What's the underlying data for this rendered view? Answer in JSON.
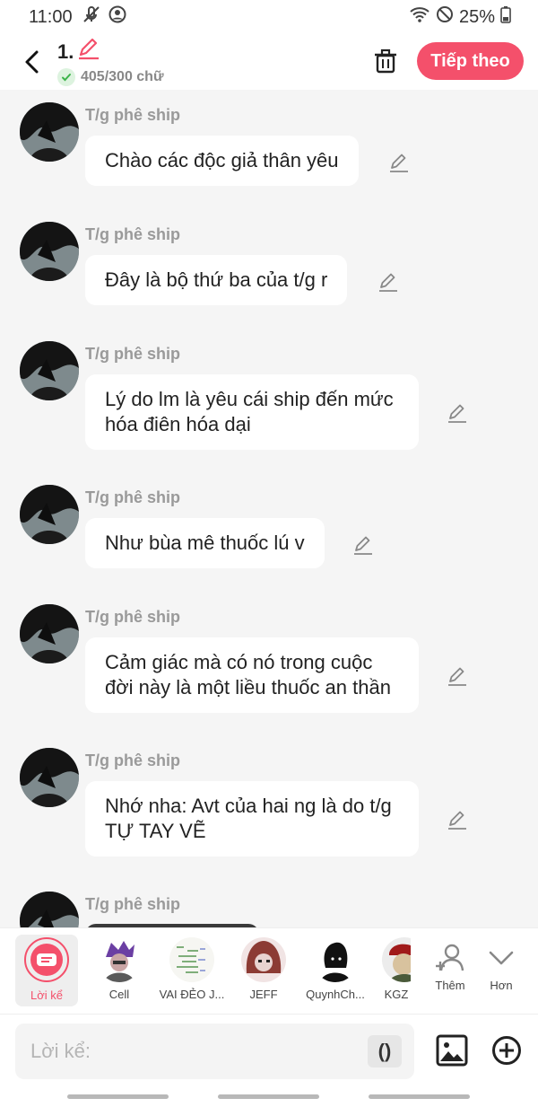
{
  "status_bar": {
    "time": "11:00",
    "battery": "25%"
  },
  "header": {
    "title": "1.",
    "word_count": "405/300 chữ",
    "next_label": "Tiếp theo"
  },
  "messages": [
    {
      "sender": "T/g phê ship",
      "text": "Chào các độc giả thân yêu"
    },
    {
      "sender": "T/g phê ship",
      "text": "Đây là bộ thứ ba của t/g r"
    },
    {
      "sender": "T/g phê ship",
      "text": "Lý do lm là yêu cái ship đến mức hóa điên hóa dại"
    },
    {
      "sender": "T/g phê ship",
      "text": "Như bùa mê thuốc lú v"
    },
    {
      "sender": "T/g phê ship",
      "text": "Cảm giác mà có nó trong cuộc đời này là một liều thuốc an thần"
    },
    {
      "sender": "T/g phê ship",
      "text": "Nhớ nha: Avt của hai ng là do t/g TỰ TAY VẼ"
    },
    {
      "sender": "T/g phê ship",
      "text": ""
    }
  ],
  "characters": {
    "narrator": "Lời kể",
    "list": [
      "Cell",
      "VAI ĐẺO J...",
      "JEFF",
      "QuynhCh...",
      "KGZ"
    ],
    "add_label": "Thêm",
    "more_label": "Hơn"
  },
  "input": {
    "placeholder": "Lời kể:",
    "paren": "()"
  },
  "colors": {
    "accent": "#f4506b",
    "background": "#f5f5f5"
  }
}
